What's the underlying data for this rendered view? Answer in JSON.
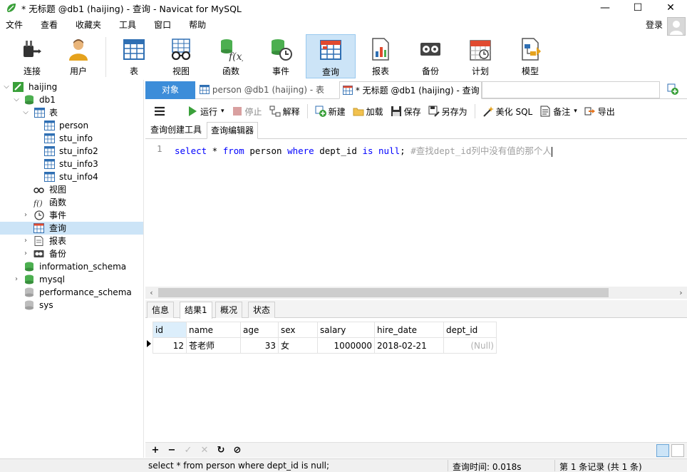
{
  "window": {
    "title": "* 无标题 @db1 (haijing) - 查询 - Navicat for MySQL",
    "minimize": "—",
    "maximize": "☐",
    "close": "✕"
  },
  "menu": {
    "items": [
      "文件",
      "查看",
      "收藏夹",
      "工具",
      "窗口",
      "帮助"
    ],
    "login": "登录"
  },
  "toolbar": {
    "connect": "连接",
    "user": "用户",
    "table": "表",
    "view": "视图",
    "function": "函数",
    "event": "事件",
    "query": "查询",
    "report": "报表",
    "backup": "备份",
    "schedule": "计划",
    "model": "模型"
  },
  "tree": {
    "connection": "haijing",
    "db": "db1",
    "tables_group": "表",
    "tables": [
      "person",
      "stu_info",
      "stu_info2",
      "stu_info3",
      "stu_info4"
    ],
    "views": "视图",
    "functions": "函数",
    "events": "事件",
    "queries": "查询",
    "reports": "报表",
    "backups": "备份",
    "other_dbs": [
      "information_schema",
      "mysql",
      "performance_schema",
      "sys"
    ]
  },
  "tabs": {
    "objects": "对象",
    "person_tab": "person @db1 (haijing) - 表",
    "query_tab": "* 无标题 @db1 (haijing) - 查询"
  },
  "query_toolbar": {
    "run": "运行",
    "stop": "停止",
    "explain": "解释",
    "new": "新建",
    "load": "加载",
    "save": "保存",
    "save_as": "另存为",
    "beautify": "美化 SQL",
    "comment": "备注",
    "export": "导出"
  },
  "subtabs": {
    "builder": "查询创建工具",
    "editor": "查询编辑器"
  },
  "editor": {
    "line_number": "1",
    "tokens": {
      "t1": "select",
      "t2": " * ",
      "t3": "from",
      "t4": " person ",
      "t5": "where",
      "t6": " dept_id ",
      "t7": "is",
      "t8": " ",
      "t9": "null",
      "t10": "; ",
      "comment": "#查找dept_id列中没有值的那个人"
    }
  },
  "result_tabs": {
    "info": "信息",
    "result1": "结果1",
    "overview": "概况",
    "status": "状态"
  },
  "grid": {
    "columns": [
      "id",
      "name",
      "age",
      "sex",
      "salary",
      "hire_date",
      "dept_id"
    ],
    "rows": [
      {
        "id": "12",
        "name": "苍老师",
        "age": "33",
        "sex": "女",
        "salary": "1000000",
        "hire_date": "2018-02-21",
        "dept_id": "(Null)"
      }
    ]
  },
  "grid_bar": {
    "add": "+",
    "remove": "−",
    "apply": "✓",
    "discard": "✕",
    "refresh": "↻",
    "stop": "⊘"
  },
  "status": {
    "sql": "select * from person where dept_id is null;",
    "query_time": "查询时间: 0.018s",
    "records": "第 1 条记录 (共 1 条)"
  }
}
